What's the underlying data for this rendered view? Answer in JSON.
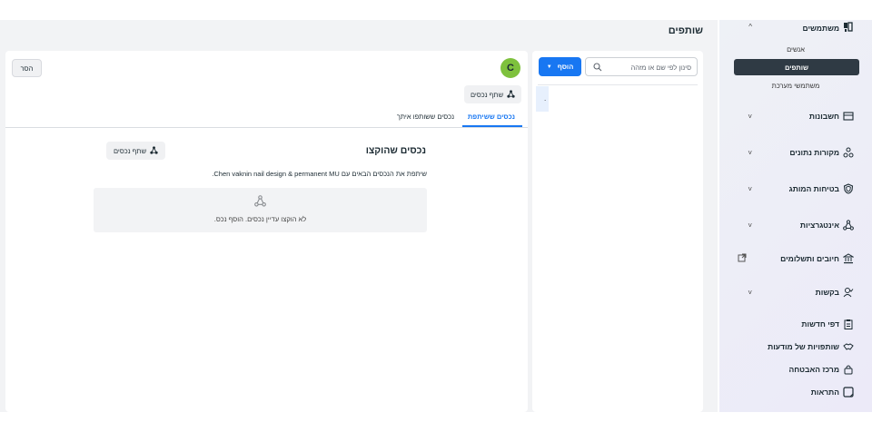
{
  "page": {
    "title": "שותפים"
  },
  "sidebar": {
    "items": [
      {
        "label": "משתמשים",
        "icon": "users-icon",
        "chevron": "^"
      },
      {
        "label": "חשבונות",
        "icon": "wallet-icon",
        "chevron": "˅"
      },
      {
        "label": "מקורות נתונים",
        "icon": "data-sources-icon",
        "chevron": "˅"
      },
      {
        "label": "בטיחות המותג",
        "icon": "shield-icon",
        "chevron": "˅"
      },
      {
        "label": "אינטגרציות",
        "icon": "integrations-icon",
        "chevron": "˅"
      },
      {
        "label": "חיובים ותשלומים",
        "icon": "bank-icon",
        "chevron": "external-link-icon"
      },
      {
        "label": "בקשות",
        "icon": "person-check-icon",
        "chevron": "˅"
      },
      {
        "label": "דפי חדשות",
        "icon": "clipboard-icon"
      },
      {
        "label": "שותפויות של מודעות",
        "icon": "handshake-icon"
      },
      {
        "label": "מרכז האבטחה",
        "icon": "lock-icon"
      },
      {
        "label": "התראות",
        "icon": "notification-icon"
      }
    ],
    "subitems": [
      {
        "label": "אנשים",
        "active": false
      },
      {
        "label": "שותפים",
        "active": true
      },
      {
        "label": "משתמשי מערכת",
        "active": false
      }
    ]
  },
  "list": {
    "search_placeholder": "סינון לפי שם או מזהה",
    "add_label": "הוסף",
    "entry_text": "."
  },
  "detail": {
    "avatar_letter": "C",
    "remove_label": "הסר",
    "share_assets_label": "שתף נכסים",
    "tabs": [
      {
        "label": "נכסים ששיתפת",
        "active": true
      },
      {
        "label": "נכסים ששותפו איתך",
        "active": false
      }
    ],
    "section_title": "נכסים שהוקצו",
    "section_share_label": "שתף נכסים",
    "section_desc": "שיתפת את הנכסים הבאים עם Chen vaknin nail design & permanent MU.",
    "empty_text": "לא הוקצו עדיין נכסים. הוסף נכס."
  },
  "colors": {
    "accent": "#1877f2",
    "avatar": "#7ec13d",
    "active_nav": "#2f3a44"
  }
}
